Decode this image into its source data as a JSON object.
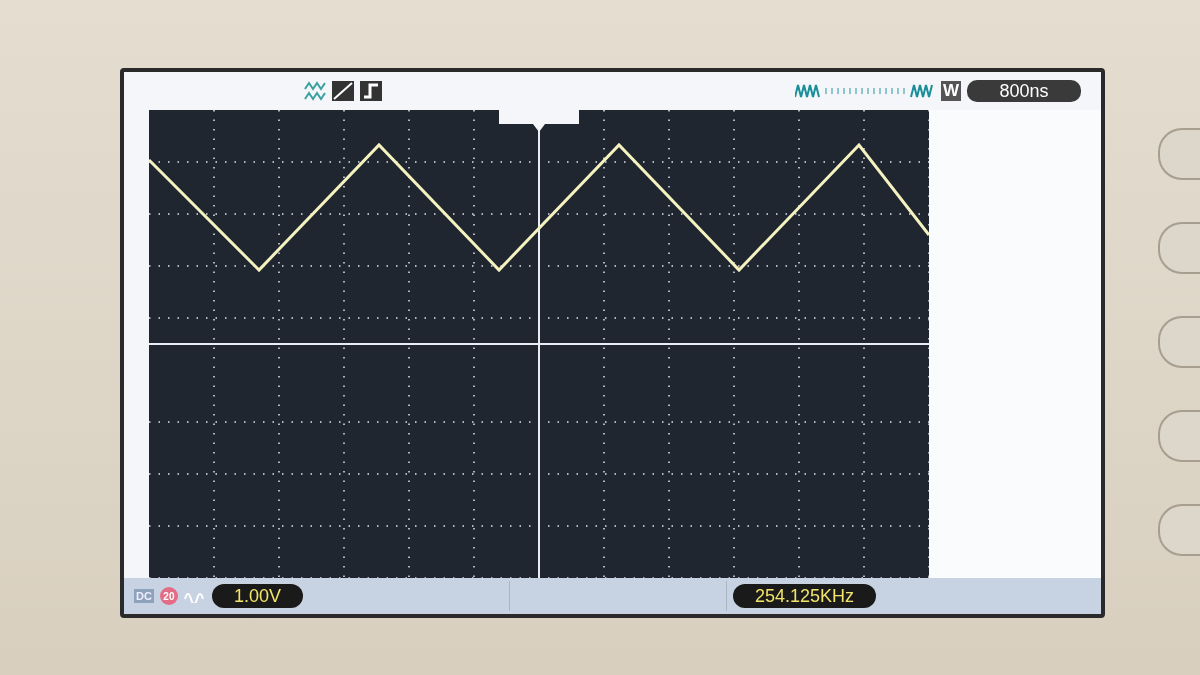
{
  "top_bar": {
    "window_mark": "W",
    "timebase": "800ns"
  },
  "bottom_bar": {
    "coupling": "DC",
    "bandwidth_limit": "20",
    "volts_div": "1.00V",
    "frequency": "254.125KHz"
  }
}
